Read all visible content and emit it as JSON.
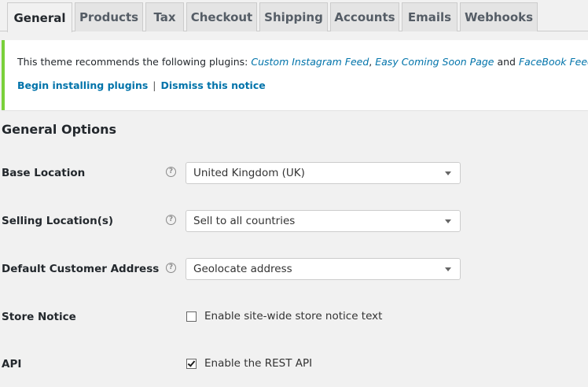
{
  "tabs": [
    {
      "label": "General",
      "active": true
    },
    {
      "label": "Products"
    },
    {
      "label": "Tax"
    },
    {
      "label": "Checkout"
    },
    {
      "label": "Shipping"
    },
    {
      "label": "Accounts"
    },
    {
      "label": "Emails"
    },
    {
      "label": "Webhooks"
    }
  ],
  "notice": {
    "text_prefix": "This theme recommends the following plugins: ",
    "plugin1": "Custom Instagram Feed",
    "comma": ", ",
    "plugin2": "Easy Coming Soon Page",
    "and": " and ",
    "plugin3": "FaceBook Feed",
    "period": ".",
    "begin_link": "Begin installing plugins",
    "separator": "|",
    "dismiss_link": "Dismiss this notice",
    "accent_color": "#7ad03a",
    "link_color": "#0073aa"
  },
  "section": {
    "title": "General Options"
  },
  "fields": {
    "base_location": {
      "label": "Base Location",
      "value": "United Kingdom (UK)"
    },
    "selling_locations": {
      "label": "Selling Location(s)",
      "value": "Sell to all countries"
    },
    "default_customer_address": {
      "label": "Default Customer Address",
      "value": "Geolocate address"
    },
    "store_notice": {
      "label": "Store Notice",
      "checkbox_label": "Enable site-wide store notice text",
      "checked": false
    },
    "api": {
      "label": "API",
      "checkbox_label": "Enable the REST API",
      "checked": true
    }
  },
  "icons": {
    "help": "help-icon",
    "dropdown": "chevron-down-icon",
    "check": "checkmark-icon"
  },
  "help_glyph": "?"
}
